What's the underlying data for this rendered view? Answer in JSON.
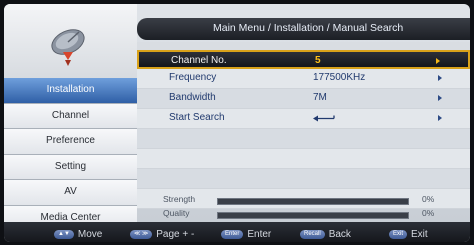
{
  "header": {
    "title": "Main Menu / Installation / Manual Search"
  },
  "menu": {
    "items": [
      {
        "label": "Installation"
      },
      {
        "label": "Channel"
      },
      {
        "label": "Preference"
      },
      {
        "label": "Setting"
      },
      {
        "label": "AV"
      },
      {
        "label": "Media Center"
      }
    ],
    "selected": "Installation"
  },
  "rows": [
    {
      "label": "Channel No.",
      "value": "5"
    },
    {
      "label": "Frequency",
      "value": "177500KHz"
    },
    {
      "label": "Bandwidth",
      "value": "7M"
    },
    {
      "label": "Start Search",
      "value": ""
    }
  ],
  "selected_row": "Channel No.",
  "meters": {
    "strength": {
      "label": "Strength",
      "value": "0%",
      "level": 0
    },
    "quality": {
      "label": "Quality",
      "value": "0%",
      "level": 0
    }
  },
  "footer": [
    {
      "key": "▲▼",
      "label": "Move"
    },
    {
      "key": "≪ ≫",
      "label": "Page + -"
    },
    {
      "key": "Enter",
      "label": "Enter"
    },
    {
      "key": "Recall",
      "label": "Back"
    },
    {
      "key": "Exit",
      "label": "Exit"
    }
  ],
  "colors": {
    "accent_selected": "#2f5fa6",
    "highlight_border": "#d9a21a",
    "highlight_value": "#ffc21a"
  },
  "icons": {
    "logo": "satellite-dish-icon",
    "row_arrow": "arrow-right-icon",
    "start_search": "enter-symbol-icon"
  }
}
